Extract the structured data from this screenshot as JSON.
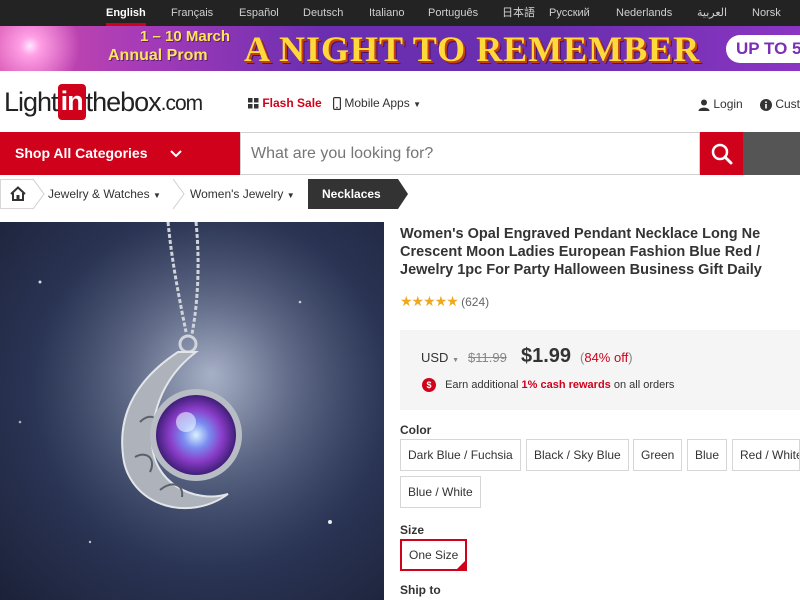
{
  "languages": [
    "English",
    "Français",
    "Español",
    "Deutsch",
    "Italiano",
    "Português",
    "日本語",
    "Русский",
    "Nederlands",
    "العربية",
    "Norsk"
  ],
  "banner": {
    "date_line": "1 – 10 March",
    "event_line": "Annual Prom",
    "headline": "A NIGHT TO REMEMBER",
    "promo": "UP TO 5"
  },
  "header": {
    "logo_light": "Light",
    "logo_in": "in",
    "logo_box": "thebox",
    "logo_com": ".com",
    "flash_sale": "Flash Sale",
    "mobile_apps": "Mobile Apps",
    "login": "Login",
    "customer": "Cust"
  },
  "nav": {
    "shop_all": "Shop All Categories",
    "search_placeholder": "What are you looking for?"
  },
  "breadcrumb": {
    "items": [
      "Jewelry & Watches",
      "Women's Jewelry"
    ],
    "current": "Necklaces"
  },
  "product": {
    "title_lines": [
      "Women's Opal Engraved Pendant Necklace Long Ne",
      "Crescent Moon Ladies European Fashion Blue Red /",
      "Jewelry 1pc For Party Halloween Business Gift Daily"
    ],
    "rating": 5,
    "review_count": "(624)",
    "currency": "USD",
    "old_price": "$11.99",
    "price": "$1.99",
    "discount_open": "(",
    "discount": "84% off",
    "discount_close": ")",
    "earn_prefix": "Earn additional",
    "earn_highlight": "1% cash rewards",
    "earn_suffix": "on all orders",
    "color_label": "Color",
    "colors": [
      "Dark Blue / Fuchsia",
      "Black / Sky Blue",
      "Green",
      "Blue",
      "Red / White",
      "Blue / White"
    ],
    "size_label": "Size",
    "sizes": [
      "One Size"
    ],
    "selected_size": "One Size",
    "ship_label": "Ship to"
  },
  "colors": {
    "brand_red": "#d0021b",
    "topbar": "#232323",
    "catbar": "#555555",
    "star": "#f0a81e"
  }
}
